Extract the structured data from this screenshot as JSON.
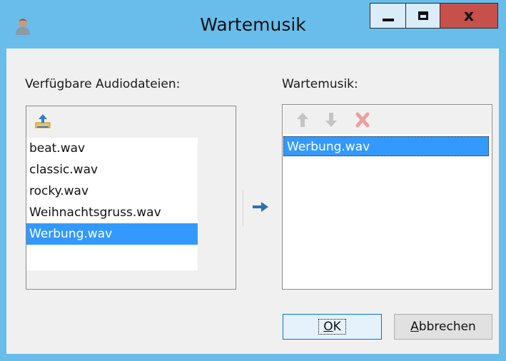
{
  "window": {
    "title": "Wartemusik",
    "icon": "user-icon",
    "controls": {
      "minimize": "minimize-icon",
      "maximize": "maximize-icon",
      "close": "x"
    }
  },
  "left_panel": {
    "label": "Verfügbare Audiodateien:",
    "toolbar_icon": "upload-icon",
    "files": [
      {
        "name": "beat.wav",
        "selected": false
      },
      {
        "name": "classic.wav",
        "selected": false
      },
      {
        "name": "rocky.wav",
        "selected": false
      },
      {
        "name": "Weihnachtsgruss.wav",
        "selected": false
      },
      {
        "name": "Werbung.wav",
        "selected": true
      }
    ]
  },
  "transfer_icon": "arrow-right-icon",
  "right_panel": {
    "label": "Wartemusik:",
    "toolbar_icons": [
      "arrow-up-icon",
      "arrow-down-icon",
      "delete-icon"
    ],
    "items": [
      {
        "name": "Werbung.wav",
        "selected": true
      }
    ]
  },
  "buttons": {
    "ok": {
      "mnemonic": "O",
      "rest": "K"
    },
    "cancel": {
      "mnemonic": "A",
      "rest": "bbrechen"
    }
  },
  "colors": {
    "titlebar": "#69bdeb",
    "selection": "#3399ff",
    "close_button": "#c7504a"
  }
}
